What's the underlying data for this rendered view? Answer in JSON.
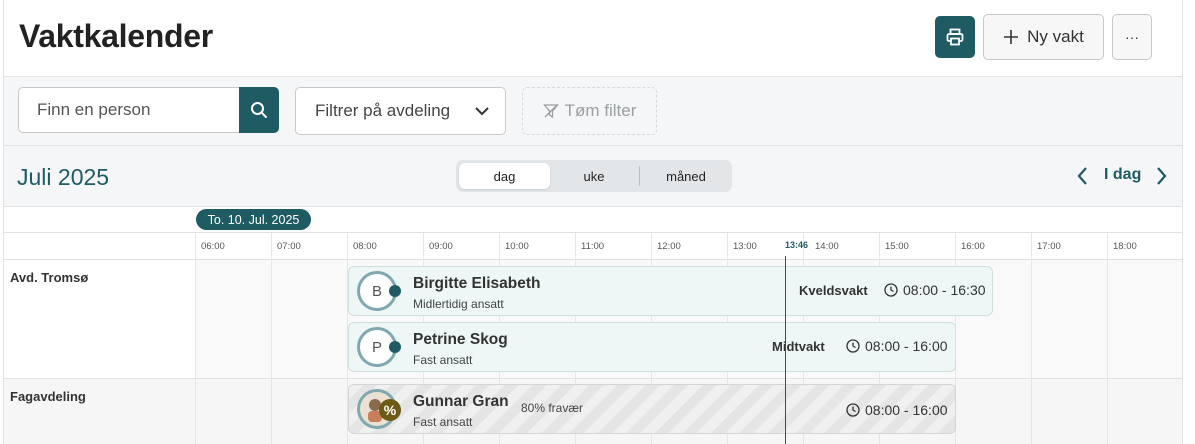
{
  "page": {
    "title": "Vaktkalender"
  },
  "toolbar": {
    "print_icon": "printer-icon",
    "new_shift_label": "Ny vakt",
    "more_label": "···"
  },
  "filters": {
    "search_placeholder": "Finn en person",
    "department_placeholder": "Filtrer på avdeling",
    "clear_label": "Tøm filter"
  },
  "period": {
    "month": "Juli 2025",
    "views": [
      {
        "label": "dag",
        "active": true
      },
      {
        "label": "uke",
        "active": false
      },
      {
        "label": "måned",
        "active": false
      }
    ],
    "today_label": "I dag"
  },
  "timeline": {
    "date_label": "To. 10. Jul. 2025",
    "hours": [
      "06:00",
      "07:00",
      "08:00",
      "09:00",
      "10:00",
      "11:00",
      "12:00",
      "13:00",
      "14:00",
      "15:00",
      "16:00",
      "17:00",
      "18:00"
    ],
    "now_label": "13:46"
  },
  "departments": [
    {
      "name": "Avd. Tromsø",
      "shifts": [
        {
          "initial": "B",
          "name": "Birgitte Elisabeth",
          "role": "Midlertidig ansatt",
          "type": "Kveldsvakt",
          "time": "08:00 - 16:30"
        },
        {
          "initial": "P",
          "name": "Petrine Skog",
          "role": "Fast ansatt",
          "type": "Midtvakt",
          "time": "08:00 - 16:00"
        }
      ]
    },
    {
      "name": "Fagavdeling",
      "shifts": [
        {
          "name": "Gunnar Gran",
          "role": "Fast ansatt",
          "absence": "80% fravær",
          "badge": "%",
          "time": "08:00 - 16:00"
        }
      ]
    }
  ],
  "colors": {
    "accent": "#1e5b63",
    "shift_bg": "#eef6f6"
  }
}
